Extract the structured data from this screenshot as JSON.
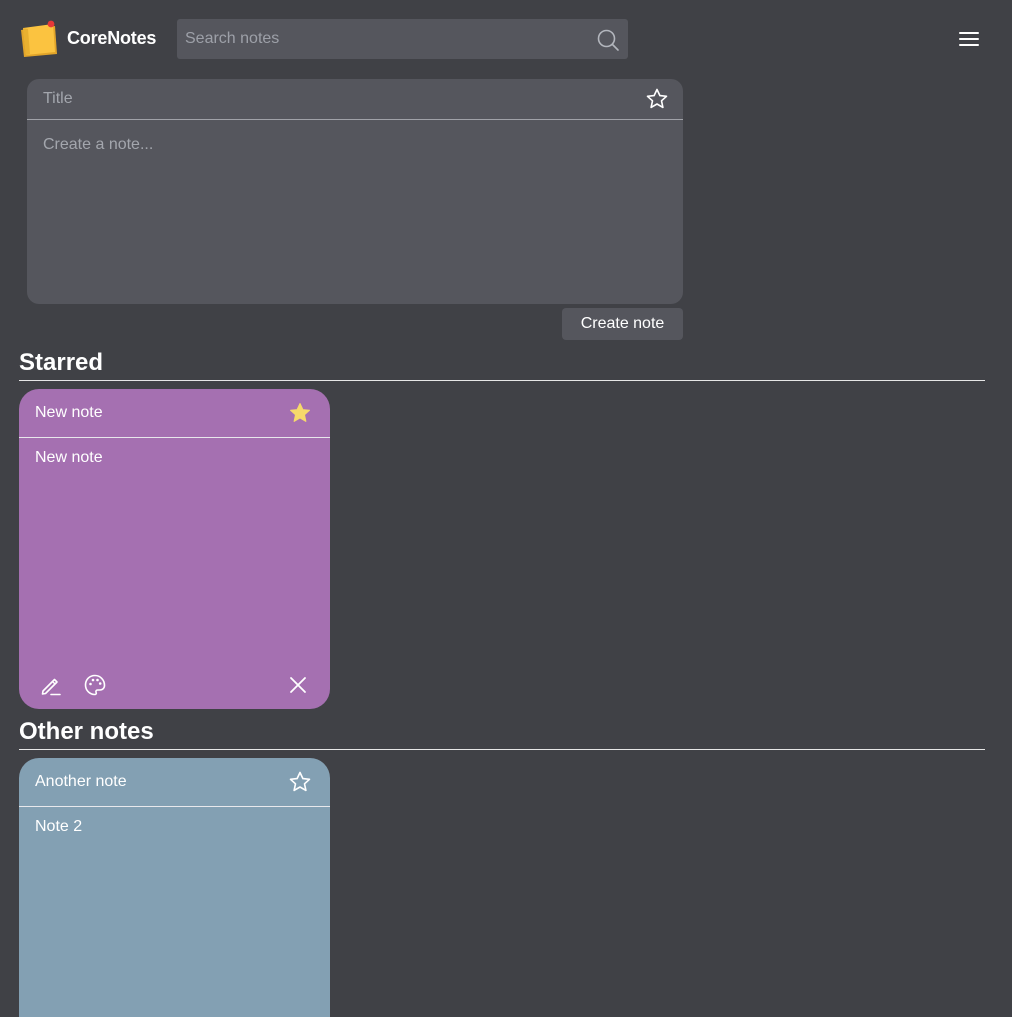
{
  "app": {
    "title": "CoreNotes"
  },
  "search": {
    "placeholder": "Search notes",
    "value": ""
  },
  "composer": {
    "title_placeholder": "Title",
    "body_placeholder": "Create a note...",
    "create_label": "Create note"
  },
  "sections": {
    "starred": {
      "title": "Starred",
      "notes": [
        {
          "title": "New note",
          "body": "New note",
          "starred": true,
          "color": "#a570b1"
        }
      ]
    },
    "other": {
      "title": "Other notes",
      "notes": [
        {
          "title": "Another note",
          "body": "Note 2",
          "starred": false,
          "color": "#83a0b3"
        }
      ]
    }
  },
  "colors": {
    "background": "#404146",
    "surface": "#55565d",
    "star_filled": "#f6d96b"
  },
  "icons": [
    "notes-logo-icon",
    "search-icon",
    "hamburger-menu-icon",
    "star-outline-icon",
    "star-filled-icon",
    "pencil-icon",
    "palette-icon",
    "close-icon"
  ]
}
